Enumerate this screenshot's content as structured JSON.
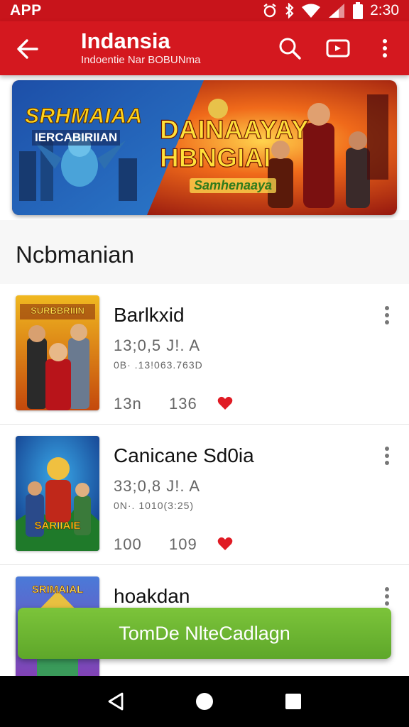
{
  "status_bar": {
    "left_label": "APP",
    "time": "2:30"
  },
  "app_bar": {
    "title": "Indansia",
    "subtitle": "Indoentie Nar BOBUNma"
  },
  "banner": {
    "text_left": "SRHMAIAA",
    "text_left_sub": "IERCABIRIIAN",
    "text_center_line1": "DAINAAYAY",
    "text_center_line2": "HBNGIAI",
    "text_tag": "Samhenaaya"
  },
  "section": {
    "title": "Ncbmanian"
  },
  "items": [
    {
      "title": "Barlkxid",
      "meta": "13;0,5 J!. A",
      "sub": "0B· .13!063.763D",
      "stat_a": "13n",
      "stat_b": "136",
      "thumb_caption": "SURBBRIIIN"
    },
    {
      "title": "Canicane Sd0ia",
      "meta": "33;0,8 J!. A",
      "sub": "0N·. 1010(3:25)",
      "stat_a": "100",
      "stat_b": "109",
      "thumb_caption": "SARIIAIE"
    },
    {
      "title": "hoakdan",
      "meta": "",
      "sub": "",
      "stat_a": "",
      "stat_b": "",
      "thumb_caption": "SRIMAIAL"
    }
  ],
  "cta": {
    "label": "TomDe NlteCadlagn"
  },
  "colors": {
    "primary": "#d4181f",
    "status": "#c8141b",
    "cta": "#6bb530",
    "heart": "#e01b24"
  }
}
